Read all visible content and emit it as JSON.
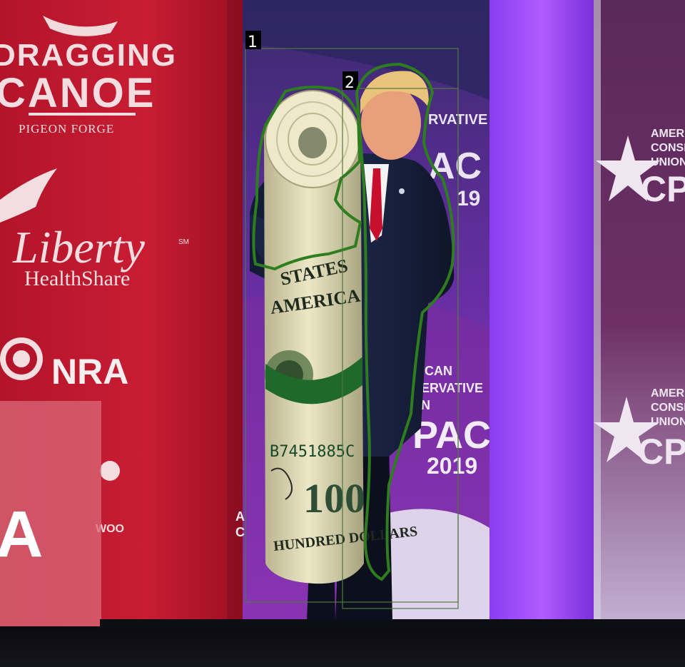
{
  "scene": {
    "backdrop_left": {
      "sponsor_1_line1": "DRAGGING",
      "sponsor_1_line2": "CANOE",
      "sponsor_1_sub": "PIGEON FORGE",
      "sponsor_2_word": "Liberty",
      "sponsor_2_sub": "HealthShare",
      "sponsor_2_mark": "SM",
      "sponsor_3": "NRA",
      "sponsor_4": "WOO",
      "podium_letter": "A"
    },
    "banner_center": {
      "line1": "ICAN",
      "line2": "ERVATIVE",
      "line3": "N",
      "cpac": "PAC",
      "year": "2019",
      "top_frag": "RVATIVE",
      "top_cpac": "AC",
      "top_year": "19",
      "left_frag_1": "A",
      "left_frag_2": "C"
    },
    "banner_right": {
      "line1": "AMERICAN",
      "line2": "CONSERVATIVE",
      "line3": "UNION",
      "cpac": "CPAC"
    },
    "money_roll": {
      "serial": "B7451885C",
      "denomination": "100",
      "text_top": "STATES",
      "text_mid": "AMERICA",
      "text_bottom": "HUNDRED DOLLARS"
    }
  },
  "annotations": [
    {
      "label": "1",
      "color": "#2e7d1e"
    },
    {
      "label": "2",
      "color": "#2e7d1e"
    }
  ]
}
